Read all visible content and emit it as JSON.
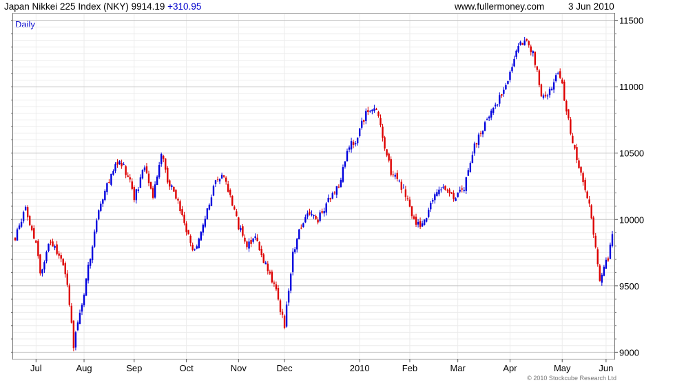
{
  "header": {
    "title": "Japan Nikkei 225 Index (NKY) 9914.19",
    "change": "+310.95",
    "website": "www.fullermoney.com",
    "date": "3 Jun 2010"
  },
  "period_label": "Daily",
  "copyright": "© 2010 Stockcube Research Ltd",
  "colors": {
    "up": "#0000dd",
    "down": "#dd0000",
    "grid": "#d6d6d6",
    "minor_grid": "#ececec"
  },
  "chart_data": {
    "type": "candlestick",
    "title": "Japan Nikkei 225 Index (NKY)",
    "ylim": [
      8950,
      11550
    ],
    "y_ticks": [
      9000,
      9500,
      10000,
      10500,
      11000,
      11500
    ],
    "y_tick_labels": [
      "9000",
      "9500",
      "10000",
      "10500",
      "11000",
      "11500"
    ],
    "x_tick_labels": [
      "Jul",
      "Aug",
      "Sep",
      "Oct",
      "Nov",
      "Dec",
      "2010",
      "Feb",
      "Mar",
      "Apr",
      "May",
      "Jun"
    ],
    "x_tick_positions": [
      10,
      33,
      57,
      82,
      107,
      129,
      165,
      189,
      212,
      237,
      262,
      283
    ],
    "n_days": 287,
    "anchors": [
      [
        0,
        9850
      ],
      [
        5,
        10100
      ],
      [
        10,
        9800
      ],
      [
        12,
        9600
      ],
      [
        17,
        9850
      ],
      [
        22,
        9700
      ],
      [
        25,
        9500
      ],
      [
        28,
        9050
      ],
      [
        32,
        9350
      ],
      [
        35,
        9650
      ],
      [
        40,
        10050
      ],
      [
        45,
        10300
      ],
      [
        50,
        10450
      ],
      [
        55,
        10300
      ],
      [
        57,
        10150
      ],
      [
        62,
        10400
      ],
      [
        66,
        10150
      ],
      [
        70,
        10500
      ],
      [
        73,
        10300
      ],
      [
        78,
        10150
      ],
      [
        82,
        9900
      ],
      [
        86,
        9750
      ],
      [
        90,
        9950
      ],
      [
        95,
        10250
      ],
      [
        100,
        10350
      ],
      [
        104,
        10100
      ],
      [
        107,
        9950
      ],
      [
        111,
        9800
      ],
      [
        115,
        9850
      ],
      [
        120,
        9650
      ],
      [
        125,
        9450
      ],
      [
        129,
        9200
      ],
      [
        133,
        9750
      ],
      [
        137,
        9950
      ],
      [
        141,
        10050
      ],
      [
        145,
        10000
      ],
      [
        150,
        10150
      ],
      [
        155,
        10250
      ],
      [
        160,
        10550
      ],
      [
        163,
        10600
      ],
      [
        168,
        10800
      ],
      [
        173,
        10850
      ],
      [
        177,
        10550
      ],
      [
        180,
        10350
      ],
      [
        185,
        10250
      ],
      [
        188,
        10150
      ],
      [
        192,
        9950
      ],
      [
        197,
        10000
      ],
      [
        200,
        10150
      ],
      [
        205,
        10250
      ],
      [
        207,
        10200
      ],
      [
        211,
        10150
      ],
      [
        215,
        10250
      ],
      [
        220,
        10550
      ],
      [
        223,
        10650
      ],
      [
        228,
        10800
      ],
      [
        233,
        10950
      ],
      [
        237,
        11100
      ],
      [
        241,
        11300
      ],
      [
        244,
        11350
      ],
      [
        248,
        11250
      ],
      [
        252,
        10950
      ],
      [
        255,
        10950
      ],
      [
        260,
        11100
      ],
      [
        262,
        11000
      ],
      [
        266,
        10650
      ],
      [
        269,
        10450
      ],
      [
        272,
        10300
      ],
      [
        275,
        10100
      ],
      [
        278,
        9800
      ],
      [
        280,
        9550
      ],
      [
        282,
        9650
      ],
      [
        284,
        9700
      ],
      [
        286,
        9900
      ]
    ],
    "volatility": 55
  }
}
